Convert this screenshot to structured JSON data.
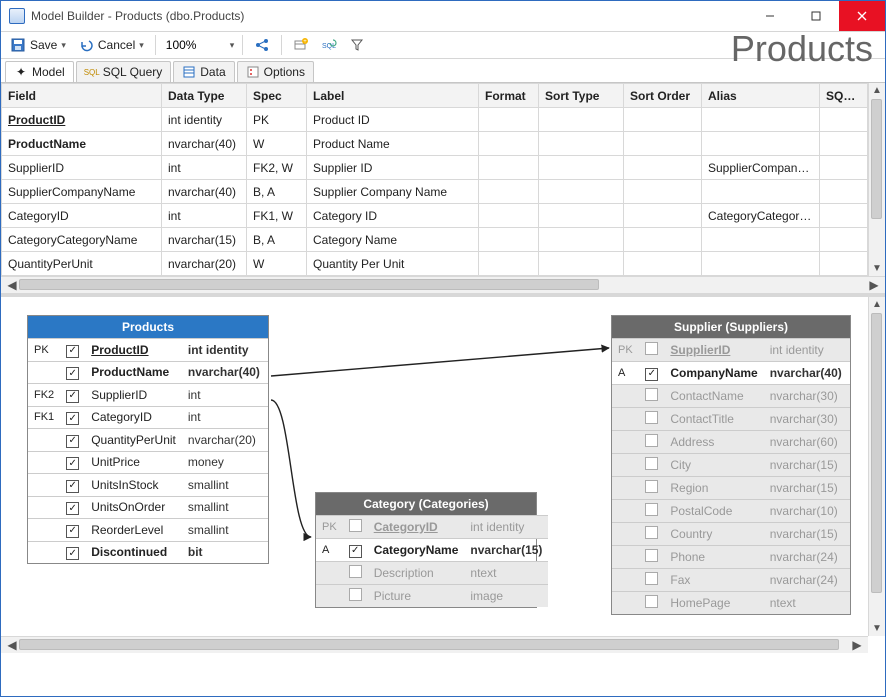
{
  "window": {
    "title": "Model Builder - Products (dbo.Products)"
  },
  "toolbar": {
    "save_label": "Save",
    "cancel_label": "Cancel",
    "zoom_value": "100%"
  },
  "heading": "Products",
  "tabs": [
    {
      "label": "Model",
      "icon": "wand"
    },
    {
      "label": "SQL Query",
      "icon": "sql"
    },
    {
      "label": "Data",
      "icon": "table"
    },
    {
      "label": "Options",
      "icon": "gear"
    }
  ],
  "grid": {
    "headers": {
      "field": "Field",
      "dataType": "Data Type",
      "spec": "Spec",
      "label": "Label",
      "format": "Format",
      "sortType": "Sort Type",
      "sortOrder": "Sort Order",
      "alias": "Alias",
      "sqlFo": "SQL Fo"
    },
    "rows": [
      {
        "field": "ProductID",
        "dataType": "int identity",
        "spec": "PK",
        "label": "Product ID",
        "format": "",
        "sortType": "",
        "sortOrder": "",
        "alias": "",
        "bold": true,
        "underline": true
      },
      {
        "field": "ProductName",
        "dataType": "nvarchar(40)",
        "spec": "W",
        "label": "Product Name",
        "format": "",
        "sortType": "",
        "sortOrder": "",
        "alias": "",
        "bold": true
      },
      {
        "field": "SupplierID",
        "dataType": "int",
        "spec": "FK2, W",
        "label": "Supplier ID",
        "format": "",
        "sortType": "",
        "sortOrder": "",
        "alias": "SupplierCompanyName"
      },
      {
        "field": "SupplierCompanyName",
        "dataType": "nvarchar(40)",
        "spec": "B, A",
        "label": "Supplier Company Name",
        "format": "",
        "sortType": "",
        "sortOrder": "",
        "alias": ""
      },
      {
        "field": "CategoryID",
        "dataType": "int",
        "spec": "FK1, W",
        "label": "Category ID",
        "format": "",
        "sortType": "",
        "sortOrder": "",
        "alias": "CategoryCategoryName"
      },
      {
        "field": "CategoryCategoryName",
        "dataType": "nvarchar(15)",
        "spec": "B, A",
        "label": "Category Name",
        "format": "",
        "sortType": "",
        "sortOrder": "",
        "alias": ""
      },
      {
        "field": "QuantityPerUnit",
        "dataType": "nvarchar(20)",
        "spec": "W",
        "label": "Quantity Per Unit",
        "format": "",
        "sortType": "",
        "sortOrder": "",
        "alias": ""
      }
    ]
  },
  "diagram": {
    "products": {
      "title": "Products",
      "rows": [
        {
          "key": "PK",
          "checked": true,
          "name": "ProductID",
          "type": "int identity",
          "pk": true,
          "req": true
        },
        {
          "key": "",
          "checked": true,
          "name": "ProductName",
          "type": "nvarchar(40)",
          "req": true
        },
        {
          "key": "FK2",
          "checked": true,
          "name": "SupplierID",
          "type": "int"
        },
        {
          "key": "FK1",
          "checked": true,
          "name": "CategoryID",
          "type": "int"
        },
        {
          "key": "",
          "checked": true,
          "name": "QuantityPerUnit",
          "type": "nvarchar(20)"
        },
        {
          "key": "",
          "checked": true,
          "name": "UnitPrice",
          "type": "money"
        },
        {
          "key": "",
          "checked": true,
          "name": "UnitsInStock",
          "type": "smallint"
        },
        {
          "key": "",
          "checked": true,
          "name": "UnitsOnOrder",
          "type": "smallint"
        },
        {
          "key": "",
          "checked": true,
          "name": "ReorderLevel",
          "type": "smallint"
        },
        {
          "key": "",
          "checked": true,
          "name": "Discontinued",
          "type": "bit",
          "req": true
        }
      ]
    },
    "category": {
      "title": "Category (Categories)",
      "rows": [
        {
          "key": "PK",
          "checked": false,
          "name": "CategoryID",
          "type": "int identity",
          "pk": true,
          "faded": true
        },
        {
          "key": "A",
          "checked": true,
          "name": "CategoryName",
          "type": "nvarchar(15)",
          "req": true
        },
        {
          "key": "",
          "checked": false,
          "name": "Description",
          "type": "ntext",
          "faded": true
        },
        {
          "key": "",
          "checked": false,
          "name": "Picture",
          "type": "image",
          "faded": true
        }
      ]
    },
    "supplier": {
      "title": "Supplier (Suppliers)",
      "rows": [
        {
          "key": "PK",
          "checked": false,
          "name": "SupplierID",
          "type": "int identity",
          "pk": true,
          "faded": true
        },
        {
          "key": "A",
          "checked": true,
          "name": "CompanyName",
          "type": "nvarchar(40)",
          "req": true
        },
        {
          "key": "",
          "checked": false,
          "name": "ContactName",
          "type": "nvarchar(30)",
          "faded": true
        },
        {
          "key": "",
          "checked": false,
          "name": "ContactTitle",
          "type": "nvarchar(30)",
          "faded": true
        },
        {
          "key": "",
          "checked": false,
          "name": "Address",
          "type": "nvarchar(60)",
          "faded": true
        },
        {
          "key": "",
          "checked": false,
          "name": "City",
          "type": "nvarchar(15)",
          "faded": true
        },
        {
          "key": "",
          "checked": false,
          "name": "Region",
          "type": "nvarchar(15)",
          "faded": true
        },
        {
          "key": "",
          "checked": false,
          "name": "PostalCode",
          "type": "nvarchar(10)",
          "faded": true
        },
        {
          "key": "",
          "checked": false,
          "name": "Country",
          "type": "nvarchar(15)",
          "faded": true
        },
        {
          "key": "",
          "checked": false,
          "name": "Phone",
          "type": "nvarchar(24)",
          "faded": true
        },
        {
          "key": "",
          "checked": false,
          "name": "Fax",
          "type": "nvarchar(24)",
          "faded": true
        },
        {
          "key": "",
          "checked": false,
          "name": "HomePage",
          "type": "ntext",
          "faded": true
        }
      ]
    }
  }
}
